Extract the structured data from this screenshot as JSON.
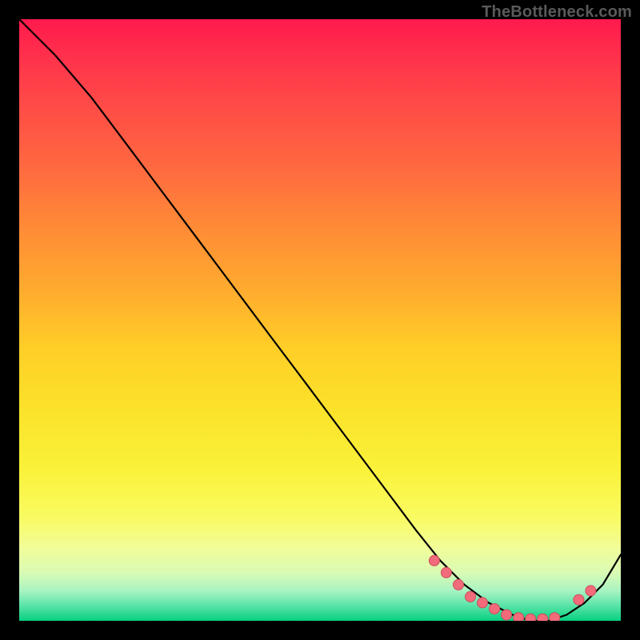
{
  "watermark": "TheBottleneck.com",
  "colors": {
    "top": "#ff1a4d",
    "mid": "#ffcf27",
    "bottom": "#07d07f",
    "curve": "#000000",
    "marker_fill": "#f26b7a",
    "marker_stroke": "#c94e5d"
  },
  "chart_data": {
    "type": "line",
    "title": "",
    "xlabel": "",
    "ylabel": "",
    "xlim": [
      0,
      100
    ],
    "ylim": [
      0,
      100
    ],
    "grid": false,
    "legend": false,
    "series": [
      {
        "name": "curve",
        "x": [
          0,
          6,
          12,
          18,
          24,
          30,
          36,
          42,
          48,
          54,
          60,
          66,
          70,
          74,
          78,
          82,
          85,
          88,
          91,
          94,
          97,
          100
        ],
        "y": [
          100,
          94,
          87,
          79,
          71,
          63,
          55,
          47,
          39,
          31,
          23,
          15,
          10,
          6,
          3,
          1,
          0,
          0,
          1,
          3,
          6,
          11
        ]
      }
    ],
    "markers": {
      "comment": "salmon dots near the valley on the curve",
      "x": [
        69,
        71,
        73,
        75,
        77,
        79,
        81,
        83,
        85,
        87,
        89,
        93,
        95
      ],
      "y": [
        10,
        8,
        6,
        4,
        3,
        2,
        1,
        0.5,
        0.3,
        0.3,
        0.5,
        3.5,
        5
      ]
    }
  }
}
